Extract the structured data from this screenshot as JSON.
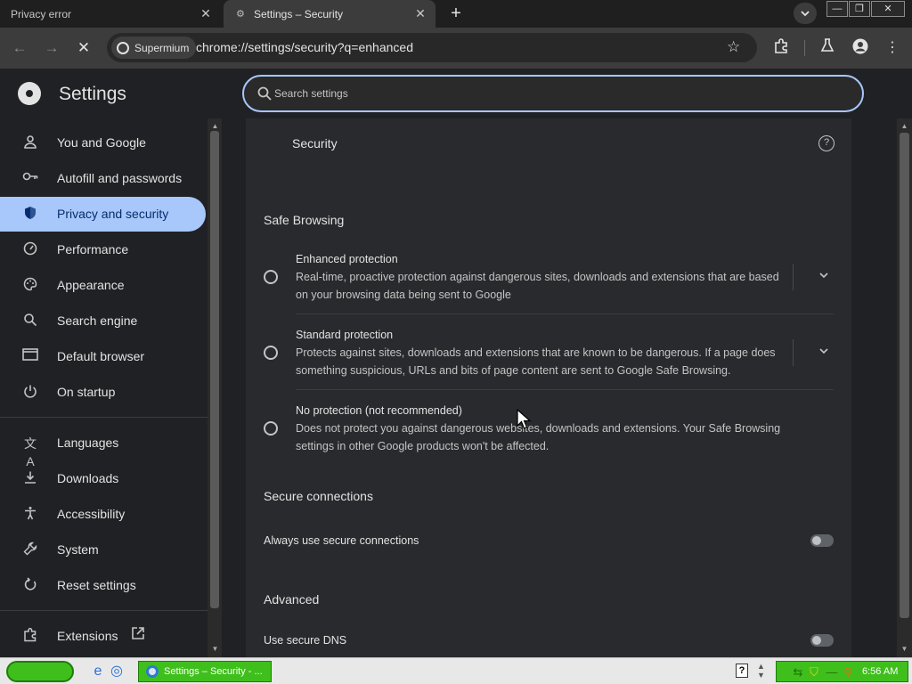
{
  "browser": {
    "tabs": [
      {
        "title": "Privacy error",
        "active": false
      },
      {
        "title": "Settings – Security",
        "active": true
      }
    ],
    "omnibox": {
      "chip_label": "Supermium",
      "url": "chrome://settings/security?q=enhanced"
    }
  },
  "settings": {
    "title": "Settings",
    "search_placeholder": "Search settings",
    "sidebar": {
      "items": [
        {
          "label": "You and Google",
          "icon": "person-icon"
        },
        {
          "label": "Autofill and passwords",
          "icon": "key-icon"
        },
        {
          "label": "Privacy and security",
          "icon": "shield-icon",
          "active": true
        },
        {
          "label": "Performance",
          "icon": "gauge-icon"
        },
        {
          "label": "Appearance",
          "icon": "palette-icon"
        },
        {
          "label": "Search engine",
          "icon": "search-icon"
        },
        {
          "label": "Default browser",
          "icon": "browser-window-icon"
        },
        {
          "label": "On startup",
          "icon": "power-icon"
        },
        {
          "label": "Languages",
          "icon": "translate-icon"
        },
        {
          "label": "Downloads",
          "icon": "download-icon"
        },
        {
          "label": "Accessibility",
          "icon": "accessibility-icon"
        },
        {
          "label": "System",
          "icon": "wrench-icon"
        },
        {
          "label": "Reset settings",
          "icon": "reset-icon"
        },
        {
          "label": "Extensions",
          "icon": "puzzle-icon"
        }
      ]
    },
    "page": {
      "section_title": "Security",
      "safe_browsing_heading": "Safe Browsing",
      "options": [
        {
          "title": "Enhanced protection",
          "description": "Real-time, proactive protection against dangerous sites, downloads and extensions that are based on your browsing data being sent to Google"
        },
        {
          "title": "Standard protection",
          "description": "Protects against sites, downloads and extensions that are known to be dangerous. If a page does something suspicious, URLs and bits of page content are sent to Google Safe Browsing."
        },
        {
          "title": "No protection (not recommended)",
          "description": "Does not protect you against dangerous websites, downloads and extensions. Your Safe Browsing settings in other Google products won't be affected."
        }
      ],
      "secure_connections_heading": "Secure connections",
      "always_secure_label": "Always use secure connections",
      "advanced_heading": "Advanced",
      "secure_dns_label": "Use secure DNS"
    }
  },
  "taskbar": {
    "task_label": "Settings – Security - ...",
    "clock": "6:56 AM"
  },
  "colors": {
    "accent": "#a8c7fa",
    "taskbar_green": "#3fbf1c"
  }
}
